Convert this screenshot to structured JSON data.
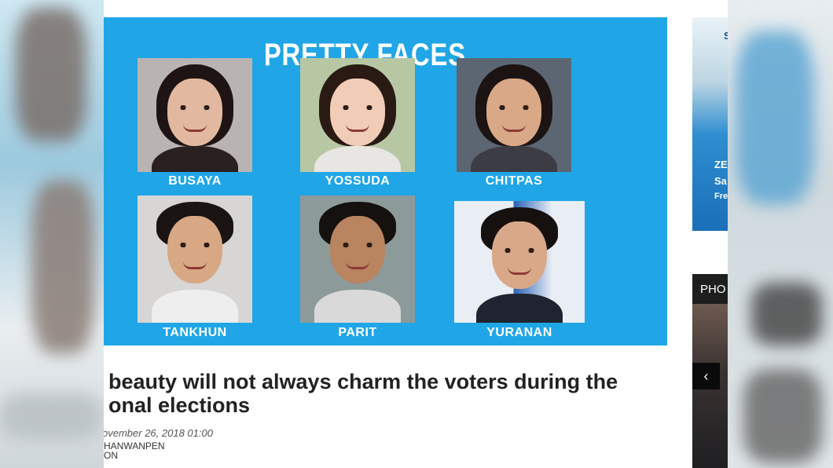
{
  "banner": {
    "title": "PRETTY FACES",
    "people": [
      {
        "name": "BUSAYA"
      },
      {
        "name": "YOSSUDA"
      },
      {
        "name": "CHITPAS"
      },
      {
        "name": "TANKHUN"
      },
      {
        "name": "PARIT"
      },
      {
        "name": "YURANAN"
      }
    ]
  },
  "article": {
    "headline_line1": "beauty will not always charm the voters during the",
    "headline_line2": "onal elections",
    "date": "ovember 26, 2018 01:00",
    "byline_line1": "HANWANPEN",
    "byline_line2": "ON"
  },
  "sidebar": {
    "ad_letters": [
      "S",
      "ZE",
      "Sa",
      "Fre"
    ],
    "photo_header": "PHO",
    "prev_icon": "chevron-left-icon",
    "prev_glyph": "‹"
  },
  "colors": {
    "banner_bg": "#20a6e6",
    "text_dark": "#222222"
  }
}
